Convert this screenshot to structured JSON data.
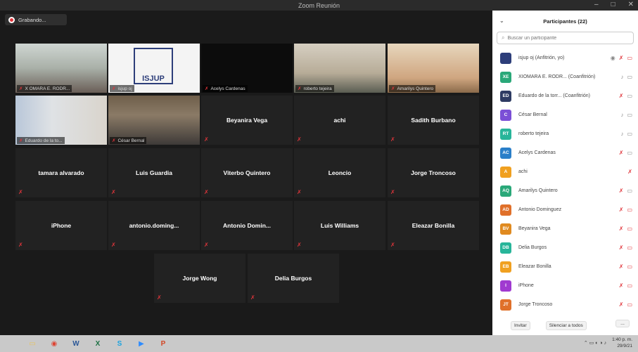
{
  "window": {
    "title": "Zoom Reunión",
    "minimize": "–",
    "maximize": "□",
    "close": "✕"
  },
  "recording": {
    "label": "Grabando..."
  },
  "tiles": [
    {
      "name": "X OMARA E. RODR...",
      "video": true,
      "label": true
    },
    {
      "name": "isjup oj",
      "video": true,
      "label": true,
      "logo_text": "ISJUP"
    },
    {
      "name": "Acelys Cardenas",
      "video": false,
      "label": true
    },
    {
      "name": "roberto tejeira",
      "video": true,
      "label": true
    },
    {
      "name": "Amarilys Quintero",
      "video": true,
      "label": true
    },
    {
      "name": "Eduardo de la to...",
      "video": true,
      "label": true
    },
    {
      "name": "César Bernal",
      "video": true,
      "label": true,
      "active": true
    },
    {
      "name": "Beyanira Vega"
    },
    {
      "name": "achi"
    },
    {
      "name": "Sadith Burbano"
    },
    {
      "name": "tamara alvarado"
    },
    {
      "name": "Luis Guardia"
    },
    {
      "name": "Viterbo Quintero"
    },
    {
      "name": "Leoncio"
    },
    {
      "name": "Jorge Troncoso"
    },
    {
      "name": "iPhone"
    },
    {
      "name": "antonio.doming..."
    },
    {
      "name": "Antonio  Domin..."
    },
    {
      "name": "Luis Williams"
    },
    {
      "name": "Eleazar Bonilla"
    },
    {
      "name": "Jorge Wong"
    },
    {
      "name": "Delia Burgos"
    }
  ],
  "participants": {
    "title": "Participantes (22)",
    "search_placeholder": "Buscar un participante",
    "list": [
      {
        "initials": "",
        "name": "isjup oj (Anfitrión, yo)",
        "color": "#2d3e7a",
        "mic": "muted",
        "cam": "off",
        "rec": true
      },
      {
        "initials": "XE",
        "name": "XIOMARA E. RODR... (Coanfitrión)",
        "color": "#2aa879",
        "mic": "on",
        "cam": "on"
      },
      {
        "initials": "ED",
        "name": "Eduardo de la torr... (Coanfitrión)",
        "color": "#2e3b63",
        "mic": "muted",
        "cam": "on"
      },
      {
        "initials": "C",
        "name": "César Bernal",
        "color": "#7b4fd6",
        "mic": "on",
        "cam": "on"
      },
      {
        "initials": "RT",
        "name": "roberto tejeira",
        "color": "#28b59a",
        "mic": "on",
        "cam": "on"
      },
      {
        "initials": "AC",
        "name": "Acelys Cardenas",
        "color": "#2a7fc9",
        "mic": "muted",
        "cam": "on"
      },
      {
        "initials": "A",
        "name": "achi",
        "color": "#f0a020",
        "mic": "muted",
        "cam": ""
      },
      {
        "initials": "AQ",
        "name": "Amarilys Quintero",
        "color": "#2aa879",
        "mic": "muted",
        "cam": "on"
      },
      {
        "initials": "AD",
        "name": "Antonio Dominguez",
        "color": "#e0702a",
        "mic": "muted",
        "cam": "off"
      },
      {
        "initials": "BV",
        "name": "Beyanira Vega",
        "color": "#e08a20",
        "mic": "muted",
        "cam": "off"
      },
      {
        "initials": "DB",
        "name": "Delia Burgos",
        "color": "#28b59a",
        "mic": "muted",
        "cam": "off"
      },
      {
        "initials": "EB",
        "name": "Eleazar Bonilla",
        "color": "#f0a020",
        "mic": "muted",
        "cam": "off"
      },
      {
        "initials": "I",
        "name": "iPhone",
        "color": "#a03ad0",
        "mic": "muted",
        "cam": "off"
      },
      {
        "initials": "JT",
        "name": "Jorge Troncoso",
        "color": "#e0702a",
        "mic": "muted",
        "cam": "off"
      }
    ],
    "invite": "Invitar",
    "mute_all": "Silenciar a todos",
    "more": "..."
  },
  "taskbar": {
    "apps": [
      {
        "icon": "folder-icon",
        "color": "#e8c25a"
      },
      {
        "icon": "chrome-icon",
        "color": "#dd4433"
      },
      {
        "icon": "word-icon",
        "color": "#2b5797"
      },
      {
        "icon": "excel-icon",
        "color": "#1e7145"
      },
      {
        "icon": "skype-icon",
        "color": "#1aa3e0"
      },
      {
        "icon": "zoom-icon",
        "color": "#2d8cff"
      },
      {
        "icon": "powerpoint-icon",
        "color": "#d24726"
      }
    ],
    "time": "1:40 p. m.",
    "date": "29/9/21"
  }
}
